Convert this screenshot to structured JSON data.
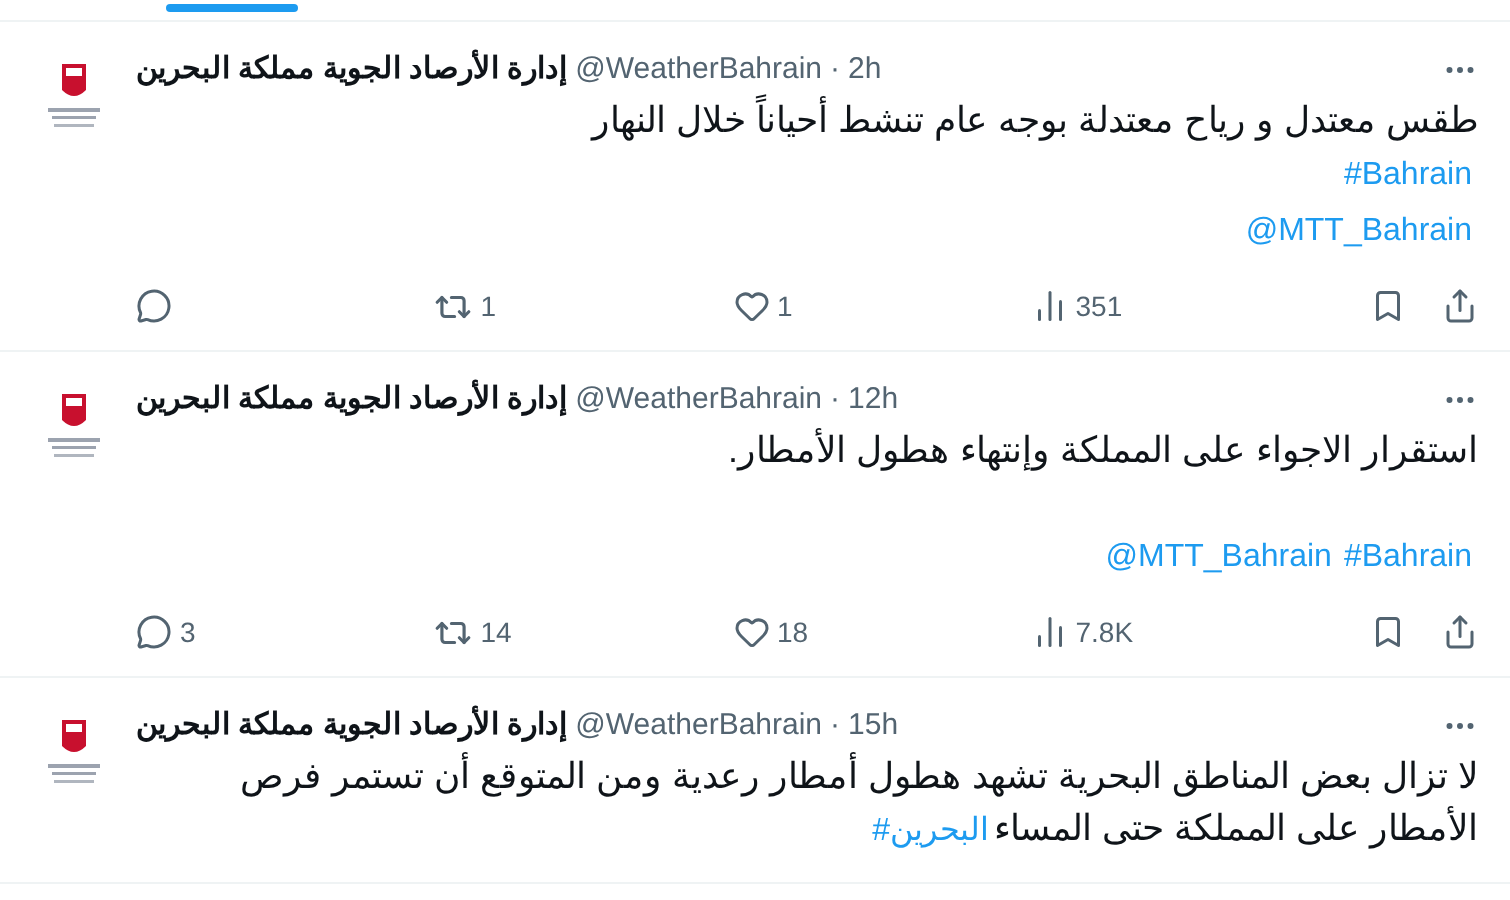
{
  "tabs_indicator": {
    "selected": true
  },
  "tweets": [
    {
      "name": "إدارة الأرصاد الجوية مملكة البحرين",
      "handle": "@WeatherBahrain",
      "separator": "·",
      "time": "2h",
      "paragraphs": [
        {
          "lines": [
            [
              {
                "kind": "text",
                "text": "طقس معتدل و رياح معتدلة بوجه عام تنشط أحياناً خلال النهار"
              }
            ],
            [
              {
                "kind": "link",
                "text": "#Bahrain"
              }
            ],
            [
              {
                "kind": "link",
                "text": "@MTT_Bahrain"
              }
            ]
          ]
        }
      ],
      "stats": {
        "retweets": "1",
        "likes": "1",
        "views": "351"
      }
    },
    {
      "name": "إدارة الأرصاد الجوية مملكة البحرين",
      "handle": "@WeatherBahrain",
      "separator": "·",
      "time": "12h",
      "paragraphs": [
        {
          "lines": [
            [
              {
                "kind": "text",
                "text": "استقرار الاجواء على المملكة وإنتهاء هطول الأمطار."
              }
            ]
          ]
        },
        {
          "lines": [
            [
              {
                "kind": "link",
                "text": "#Bahrain"
              },
              {
                "kind": "link",
                "text": "@MTT_Bahrain"
              }
            ]
          ]
        }
      ],
      "stats": {
        "replies": "3",
        "retweets": "14",
        "likes": "18",
        "views": "7.8K"
      }
    },
    {
      "name": "إدارة الأرصاد الجوية مملكة البحرين",
      "handle": "@WeatherBahrain",
      "separator": "·",
      "time": "15h",
      "paragraphs": [
        {
          "lines": [
            [
              {
                "kind": "text",
                "text": "لا تزال بعض المناطق البحرية تشهد هطول أمطار رعدية ومن المتوقع أن تستمر فرص الأمطار على المملكة حتى المساء"
              },
              {
                "kind": "link",
                "text": "#البحرين"
              }
            ]
          ]
        }
      ]
    }
  ]
}
